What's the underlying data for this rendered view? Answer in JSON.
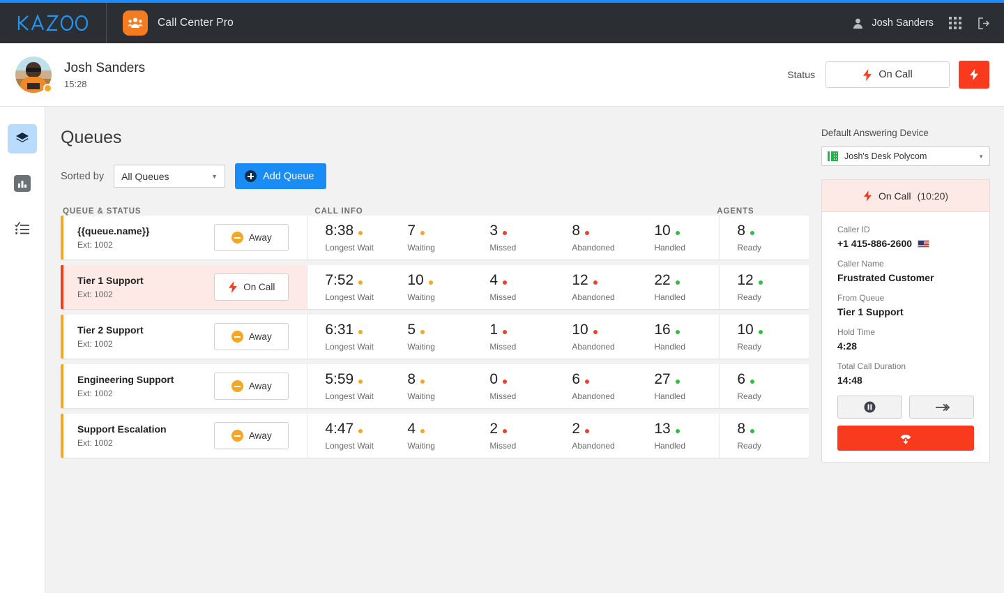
{
  "theme": {
    "accent_blue": "#1a8cf5",
    "brand_orange": "#f47b20",
    "status_red": "#f93a1e",
    "status_orange": "#f5a623",
    "status_green": "#2fbf3f",
    "topnav_bg": "#2b2f33"
  },
  "topnav": {
    "logo_text": "KAZOO",
    "app_title": "Call Center Pro",
    "app_icon": "call-center-group-icon",
    "user_name": "Josh Sanders",
    "user_icon": "user-avatar-icon",
    "apps_icon": "apps-grid-icon",
    "logout_icon": "logout-icon"
  },
  "userbar": {
    "name": "Josh Sanders",
    "time": "15:28",
    "avatar_icon": "user-photo-avatar",
    "presence": "away",
    "status_label": "Status",
    "status_value": "On Call",
    "status_icon": "lightning-bolt-icon",
    "flash_button_icon": "lightning-bolt-icon"
  },
  "sidebar": {
    "items": [
      {
        "name": "queues",
        "icon": "layers-icon",
        "active": true
      },
      {
        "name": "reports",
        "icon": "bar-chart-icon",
        "active": false
      },
      {
        "name": "tasks",
        "icon": "checklist-icon",
        "active": false
      }
    ]
  },
  "main": {
    "page_title": "Queues",
    "sorted_by_label": "Sorted by",
    "sort_value": "All Queues",
    "sort_options": [
      "All Queues"
    ],
    "add_button": "Add Queue",
    "columns": {
      "queue_status": "QUEUE & STATUS",
      "call_info": "CALL INFO",
      "agents": "AGENTS"
    },
    "stat_labels": {
      "longest_wait": "Longest Wait",
      "waiting": "Waiting",
      "missed": "Missed",
      "abandoned": "Abandoned",
      "handled": "Handled",
      "ready": "Ready"
    },
    "rows": [
      {
        "name": "{{queue.name}}",
        "ext": "Ext: 1002",
        "status": "Away",
        "status_type": "away",
        "longest_wait": "8:38",
        "waiting": "7",
        "missed": "3",
        "abandoned": "8",
        "handled": "10",
        "ready": "8"
      },
      {
        "name": "Tier 1 Support",
        "ext": "Ext: 1002",
        "status": "On Call",
        "status_type": "oncall",
        "longest_wait": "7:52",
        "waiting": "10",
        "missed": "4",
        "abandoned": "12",
        "handled": "22",
        "ready": "12"
      },
      {
        "name": "Tier 2 Support",
        "ext": "Ext: 1002",
        "status": "Away",
        "status_type": "away",
        "longest_wait": "6:31",
        "waiting": "5",
        "missed": "1",
        "abandoned": "10",
        "handled": "16",
        "ready": "10"
      },
      {
        "name": "Engineering Support",
        "ext": "Ext: 1002",
        "status": "Away",
        "status_type": "away",
        "longest_wait": "5:59",
        "waiting": "8",
        "missed": "0",
        "abandoned": "6",
        "handled": "27",
        "ready": "6"
      },
      {
        "name": "Support Escalation",
        "ext": "Ext: 1002",
        "status": "Away",
        "status_type": "away",
        "longest_wait": "4:47",
        "waiting": "4",
        "missed": "2",
        "abandoned": "2",
        "handled": "13",
        "ready": "8"
      }
    ]
  },
  "right_panel": {
    "device_label": "Default Answering Device",
    "device_value": "Josh's Desk Polycom",
    "device_icon": "desk-phone-icon",
    "call_status": "On Call",
    "call_status_icon": "lightning-bolt-icon",
    "call_duration": "(10:20)",
    "fields": [
      {
        "label": "Caller ID",
        "value": "+1 415-886-2600",
        "flag": "us-flag-icon"
      },
      {
        "label": "Caller Name",
        "value": "Frustrated Customer"
      },
      {
        "label": "From Queue",
        "value": "Tier 1 Support"
      },
      {
        "label": "Hold Time",
        "value": "4:28"
      },
      {
        "label": "Total Call Duration",
        "value": "14:48"
      }
    ],
    "hold_icon": "pause-icon",
    "transfer_icon": "transfer-arrow-icon",
    "hangup_icon": "hang-up-phone-icon"
  }
}
